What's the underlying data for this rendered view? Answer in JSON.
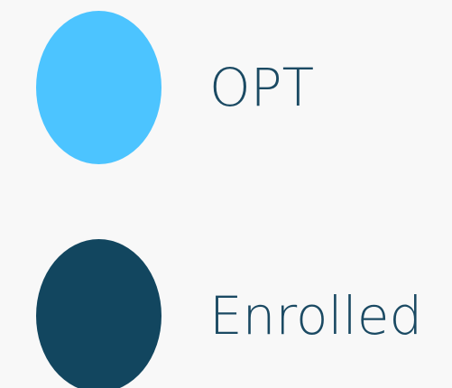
{
  "chart_data": {
    "type": "pie",
    "legend": [
      {
        "label": "OPT",
        "color": "#4cc4ff"
      },
      {
        "label": "Enrolled",
        "color": "#12465f"
      }
    ]
  },
  "text_color": "#1b4a63",
  "background": "#f8f8f8"
}
